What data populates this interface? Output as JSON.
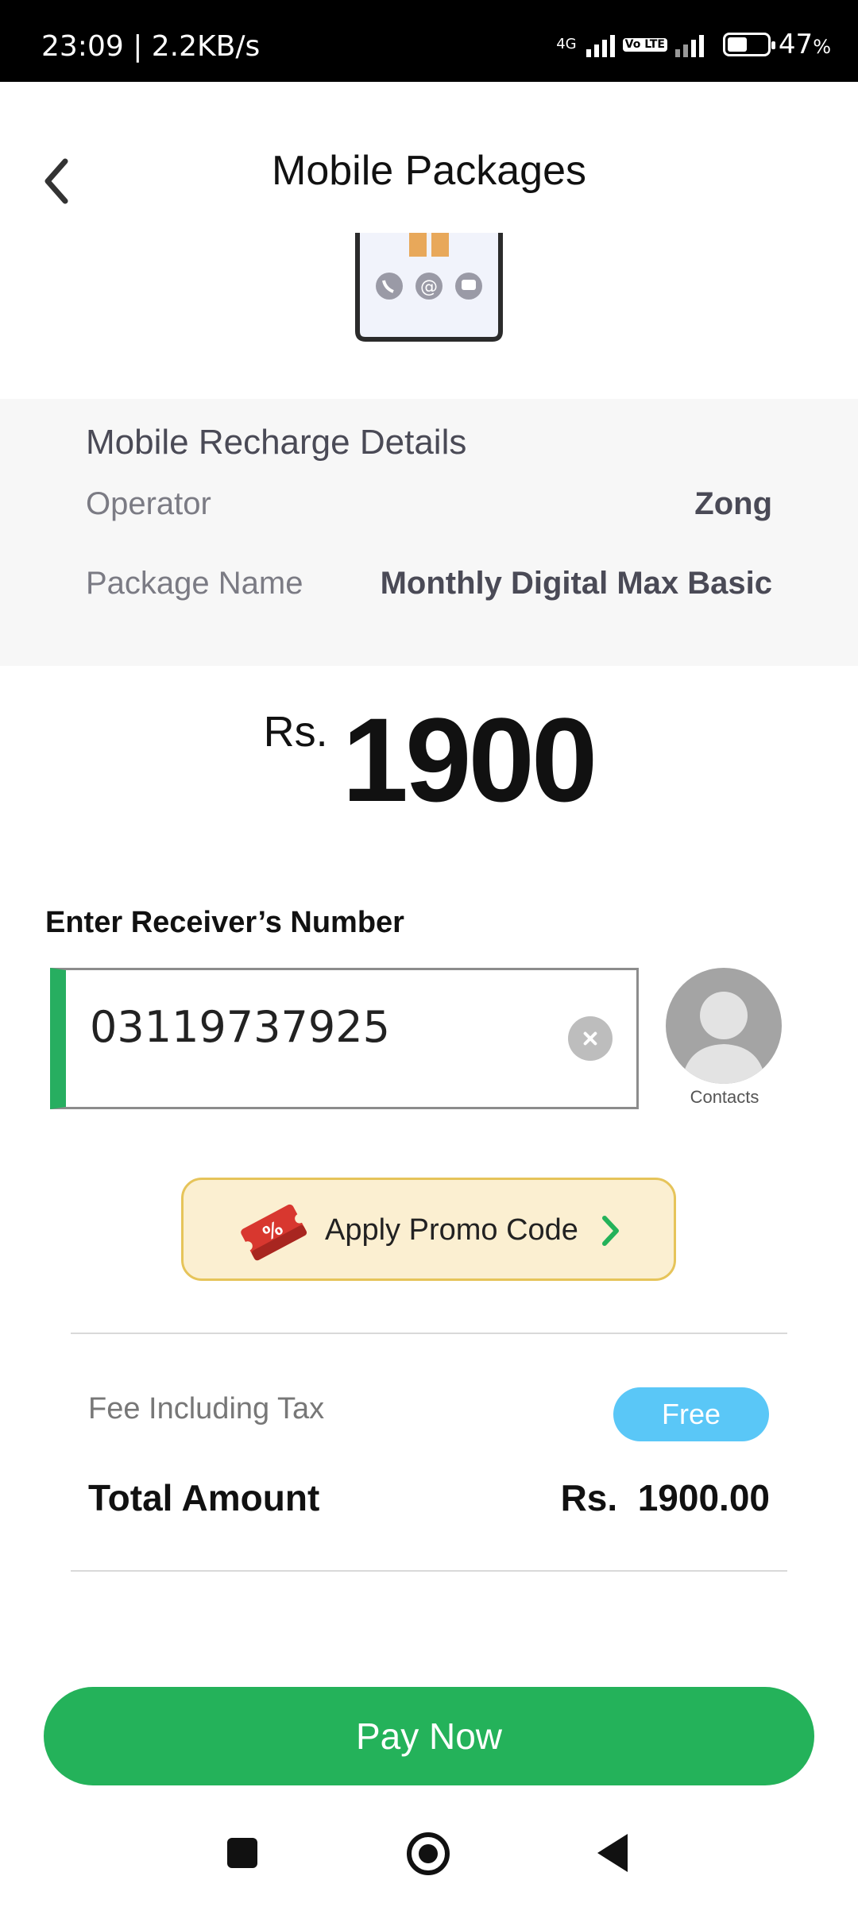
{
  "status_bar": {
    "time": "23:09",
    "speed": "2.2KB/s",
    "network_tag": "4G",
    "volte": "Vo LTE",
    "battery": "47",
    "battery_unit": "%"
  },
  "header": {
    "title": "Mobile Packages",
    "back_icon": "chevron-left-icon"
  },
  "details": {
    "heading": "Mobile Recharge Details",
    "rows": [
      {
        "label": "Operator",
        "value": "Zong"
      },
      {
        "label": "Package Name",
        "value": "Monthly Digital Max Basic"
      }
    ]
  },
  "amount": {
    "currency": "Rs.",
    "value": "1900"
  },
  "receiver": {
    "label": "Enter Receiver’s Number",
    "number": "03119737925",
    "contacts_label": "Contacts"
  },
  "promo": {
    "label": "Apply Promo Code",
    "icon": "coupon-icon",
    "arrow": "chevron-right-icon"
  },
  "summary": {
    "fee_label": "Fee Including Tax",
    "fee_badge": "Free",
    "total_label": "Total Amount",
    "total_value": "Rs.  1900.00"
  },
  "pay_button": "Pay Now",
  "colors": {
    "accent_green": "#24b25a",
    "badge_blue": "#5ac7f7",
    "promo_bg": "#fbefd1",
    "promo_border": "#e6c45a"
  }
}
